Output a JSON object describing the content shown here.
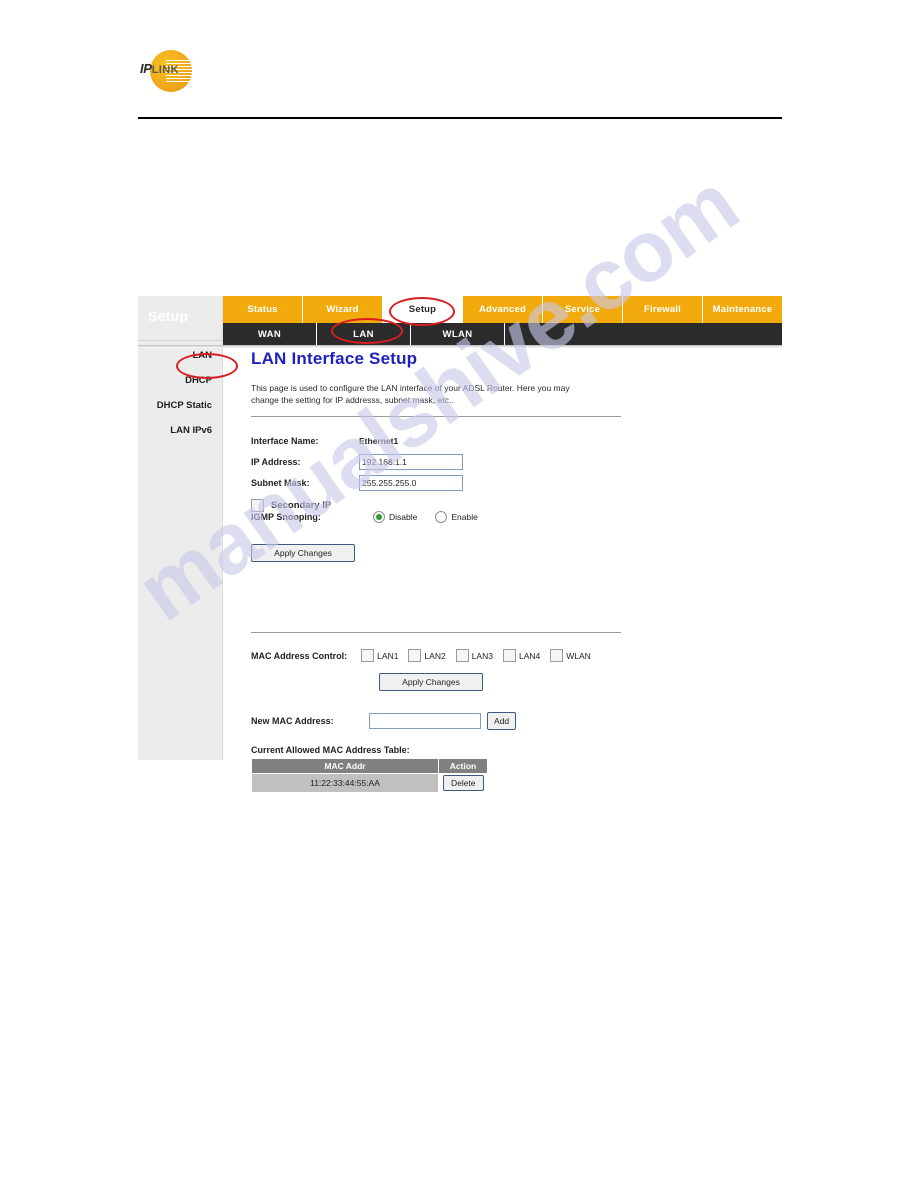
{
  "brand": {
    "logo_primary": "IP",
    "logo_secondary": "LINK",
    "logo_color": "#f0a81c"
  },
  "watermark": {
    "text": "manualshive.com",
    "color": "#c9c9ea"
  },
  "router_ui": {
    "sidebar": {
      "title": "Setup",
      "items": [
        {
          "label": "LAN"
        },
        {
          "label": "DHCP"
        },
        {
          "label": "DHCP Static"
        },
        {
          "label": "LAN IPv6"
        }
      ]
    },
    "main_tabs": [
      {
        "label": "Status",
        "active": false
      },
      {
        "label": "Wizard",
        "active": false
      },
      {
        "label": "Setup",
        "active": true
      },
      {
        "label": "Advanced",
        "active": false
      },
      {
        "label": "Service",
        "active": false
      },
      {
        "label": "Firewall",
        "active": false
      },
      {
        "label": "Maintenance",
        "active": false
      }
    ],
    "sub_tabs": [
      {
        "label": "WAN",
        "active": false
      },
      {
        "label": "LAN",
        "active": true
      },
      {
        "label": "WLAN",
        "active": false
      }
    ],
    "content": {
      "title": "LAN Interface Setup",
      "description": "This page is used to configure the LAN interface of your ADSL Router. Here you may change the setting for IP addresss, subnet mask, etc..",
      "fields": {
        "interface_name_label": "Interface Name:",
        "interface_name_value": "Ethernet1",
        "ip_address_label": "IP Address:",
        "ip_address_value": "192.168.1.1",
        "subnet_mask_label": "Subnet Mask:",
        "subnet_mask_value": "255.255.255.0",
        "secondary_ip_label": "Secondary IP",
        "secondary_ip_checked": false
      },
      "igmp": {
        "label": "IGMP Snooping:",
        "options": [
          {
            "label": "Disable",
            "selected": true
          },
          {
            "label": "Enable",
            "selected": false
          }
        ]
      },
      "apply_changes_1": "Apply Changes",
      "mac_control": {
        "label": "MAC Address Control:",
        "options": [
          {
            "label": "LAN1",
            "checked": false
          },
          {
            "label": "LAN2",
            "checked": false
          },
          {
            "label": "LAN3",
            "checked": false
          },
          {
            "label": "LAN4",
            "checked": false
          },
          {
            "label": "WLAN",
            "checked": false
          }
        ]
      },
      "apply_changes_2": "Apply Changes",
      "new_mac": {
        "label": "New MAC Address:",
        "value": "",
        "placeholder": "",
        "add_button": "Add"
      },
      "mac_table": {
        "caption": "Current Allowed MAC Address Table:",
        "headers": [
          "MAC Addr",
          "Action"
        ],
        "rows": [
          {
            "mac": "11:22:33:44:55:AA",
            "action": "Delete"
          }
        ]
      }
    }
  }
}
